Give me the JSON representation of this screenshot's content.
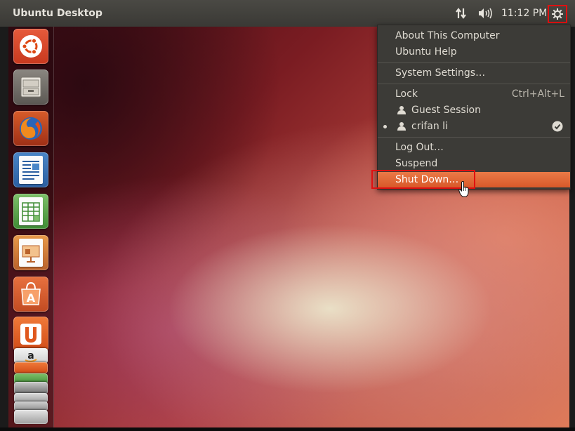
{
  "top_panel": {
    "window_title": "Ubuntu Desktop",
    "clock": "11:12 PM",
    "indicators": [
      "network-icon",
      "volume-icon",
      "session-gear-icon"
    ]
  },
  "launcher": {
    "items": [
      {
        "icon": "ubuntu-logo-icon"
      },
      {
        "icon": "files-cabinet-icon"
      },
      {
        "icon": "firefox-icon"
      },
      {
        "icon": "libreoffice-writer-icon"
      },
      {
        "icon": "libreoffice-calc-icon"
      },
      {
        "icon": "libreoffice-impress-icon"
      },
      {
        "icon": "software-center-icon"
      },
      {
        "icon": "ubuntu-one-icon"
      },
      {
        "icon": "amazon-icon"
      }
    ]
  },
  "session_menu": {
    "about": "About This Computer",
    "help": "Ubuntu Help",
    "settings": "System Settings…",
    "lock": "Lock",
    "lock_accel": "Ctrl+Alt+L",
    "guest": "Guest Session",
    "user": "crifan li",
    "logout": "Log Out…",
    "suspend": "Suspend",
    "shutdown": "Shut Down…"
  },
  "colors": {
    "panel": "#3c3b37",
    "highlight": "#e8713f",
    "annotation": "#e01010"
  }
}
